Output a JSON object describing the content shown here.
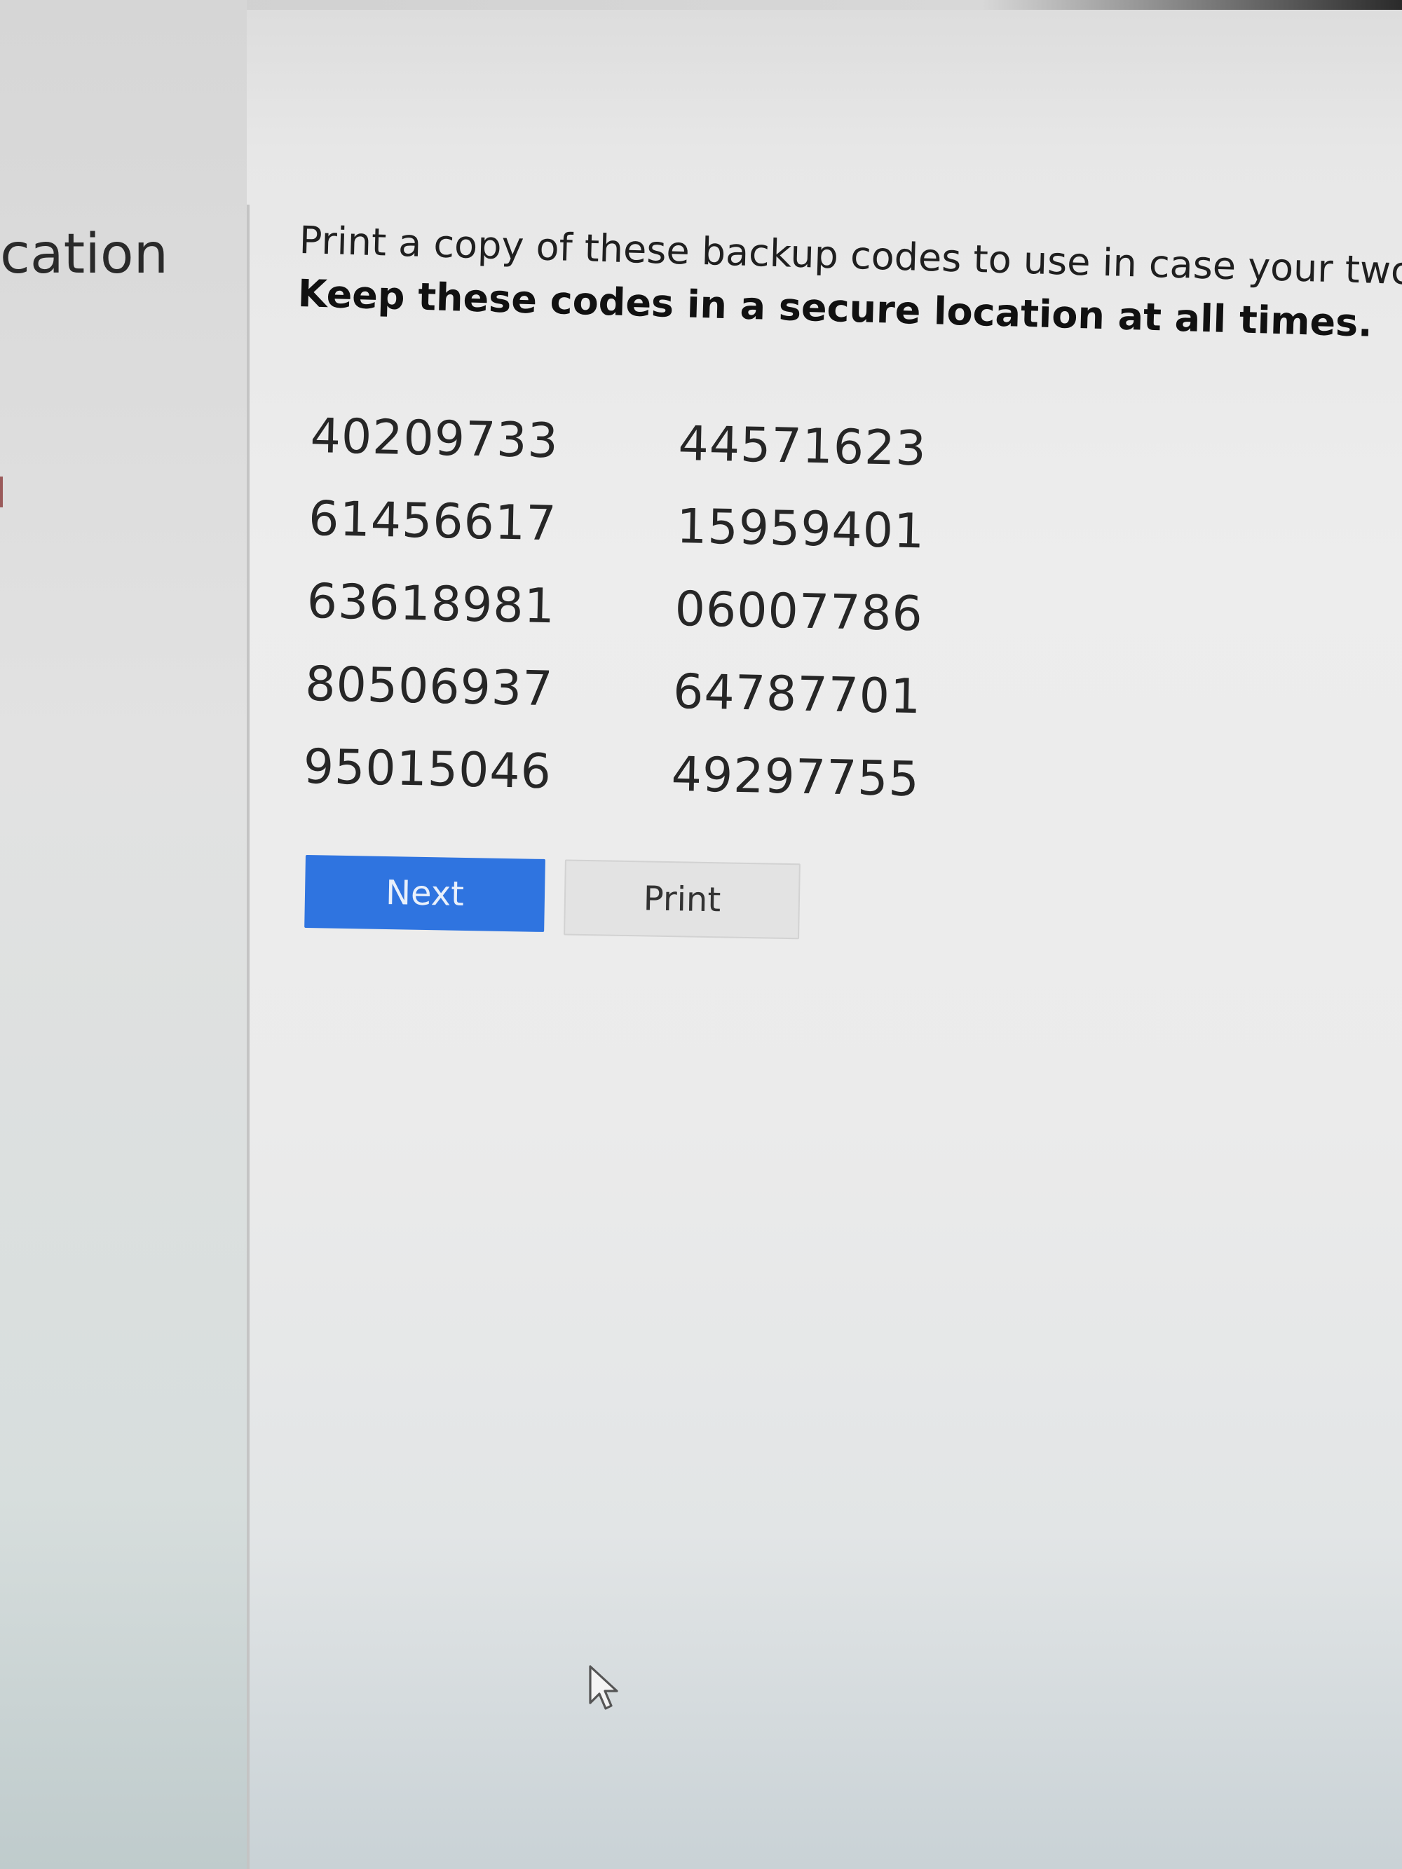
{
  "sidebar": {
    "title_fragment": "cation"
  },
  "instructions": {
    "line1": "Print a copy of these backup codes to use in case your two-f",
    "line2": "Keep these codes in a secure location at all times."
  },
  "codes": {
    "left": [
      "40209733",
      "61456617",
      "63618981",
      "80506937",
      "95015046"
    ],
    "right": [
      "44571623",
      "15959401",
      "06007786",
      "64787701",
      "49297755"
    ]
  },
  "actions": {
    "next_label": "Next",
    "print_label": "Print"
  },
  "colors": {
    "primary_button": "#2f74e0",
    "secondary_button": "#e3e3e3"
  },
  "icons": {
    "cursor": "mouse-pointer-icon"
  }
}
